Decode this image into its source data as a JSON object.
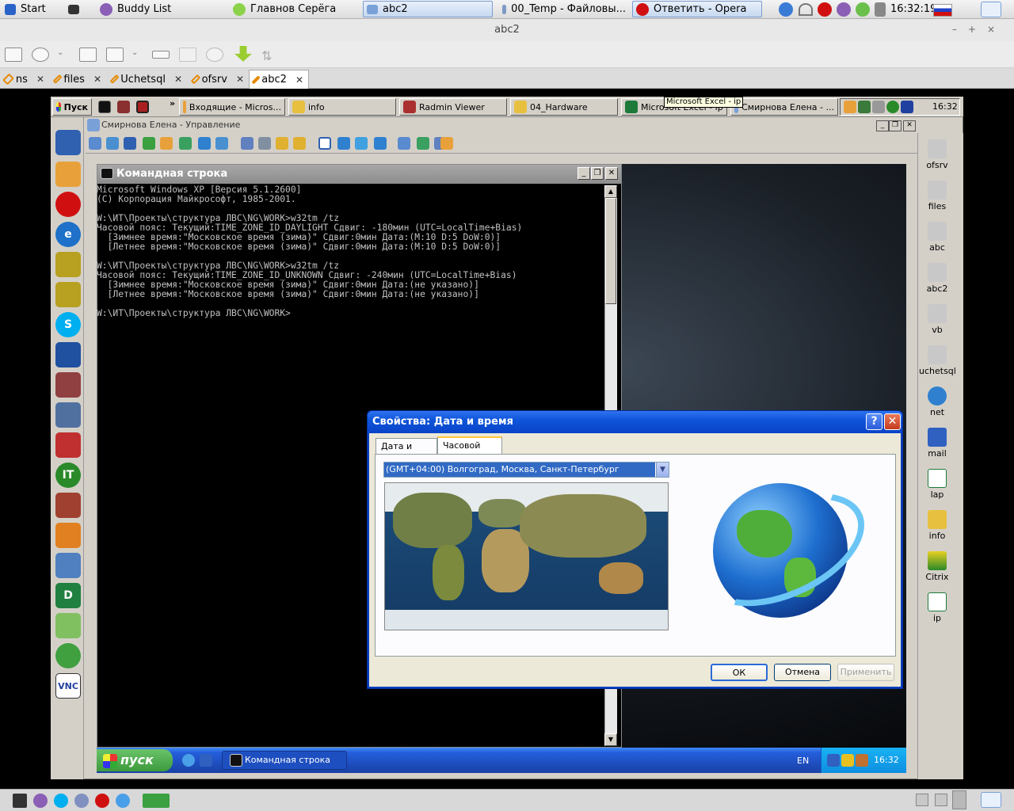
{
  "host": {
    "taskbar": {
      "start": "Start",
      "buddy": "Buddy List",
      "tasks": [
        "Главнов Серёга",
        "abc2",
        "00_Temp - Файловы...",
        "Ответить - Opera"
      ],
      "clock": "16:32:19"
    },
    "window_title": "abc2",
    "tabs": [
      "ns",
      "files",
      "Uchetsql",
      "ofsrv",
      "abc2"
    ]
  },
  "remote": {
    "taskbar": {
      "start": "Пуск",
      "more": "»",
      "tasks": [
        "Входящие - Micros...",
        "info",
        "Radmin Viewer",
        "04_Hardware",
        "Microsoft Excel - ip",
        "Смирнова Елена - ..."
      ],
      "clock": "16:32",
      "tooltip": "Microsoft Excel - ip"
    },
    "title": "Смирнова Елена - Управление",
    "right_items": [
      "ofsrv",
      "files",
      "abc",
      "abc2",
      "vb",
      "uchetsql",
      "net",
      "mail",
      "lap",
      "info",
      "Citrix",
      "ip"
    ],
    "cmd": {
      "title": "Командная строка",
      "lines": [
        "Microsoft Windows XP [Версия 5.1.2600]",
        "(С) Корпорация Майкрософт, 1985-2001.",
        "",
        "W:\\ИТ\\Проекты\\структура ЛВС\\NG\\WORK>w32tm /tz",
        "Часовой пояс: Текущий:TIME_ZONE_ID_DAYLIGHT Сдвиг: -180мин (UTC=LocalTime+Bias)",
        "  [Зимнее время:\"Московское время (зима)\" Сдвиг:0мин Дата:(M:10 D:5 DoW:0)]",
        "  [Летнее время:\"Московское время (зима)\" Сдвиг:0мин Дата:(M:10 D:5 DoW:0)]",
        "",
        "W:\\ИТ\\Проекты\\структура ЛВС\\NG\\WORK>w32tm /tz",
        "Часовой пояс: Текущий:TIME_ZONE_ID_UNKNOWN Сдвиг: -240мин (UTC=LocalTime+Bias)",
        "  [Зимнее время:\"Московское время (зима)\" Сдвиг:0мин Дата:(не указано)]",
        "  [Летнее время:\"Московское время (зима)\" Сдвиг:0мин Дата:(не указано)]",
        "",
        "W:\\ИТ\\Проекты\\структура ЛВС\\NG\\WORK>"
      ]
    },
    "dialog": {
      "title": "Свойства: Дата и время",
      "help": "?",
      "close": "✕",
      "tabs": [
        "Дата и время",
        "Часовой пояс"
      ],
      "timezone": "(GMT+04:00) Волгоград, Москва, Санкт-Петербург",
      "ok": "ОК",
      "cancel": "Отмена",
      "apply": "Применить"
    },
    "xp_taskbar": {
      "start": "пуск",
      "task": "Командная строка",
      "lang": "EN",
      "clock": "16:32"
    }
  }
}
